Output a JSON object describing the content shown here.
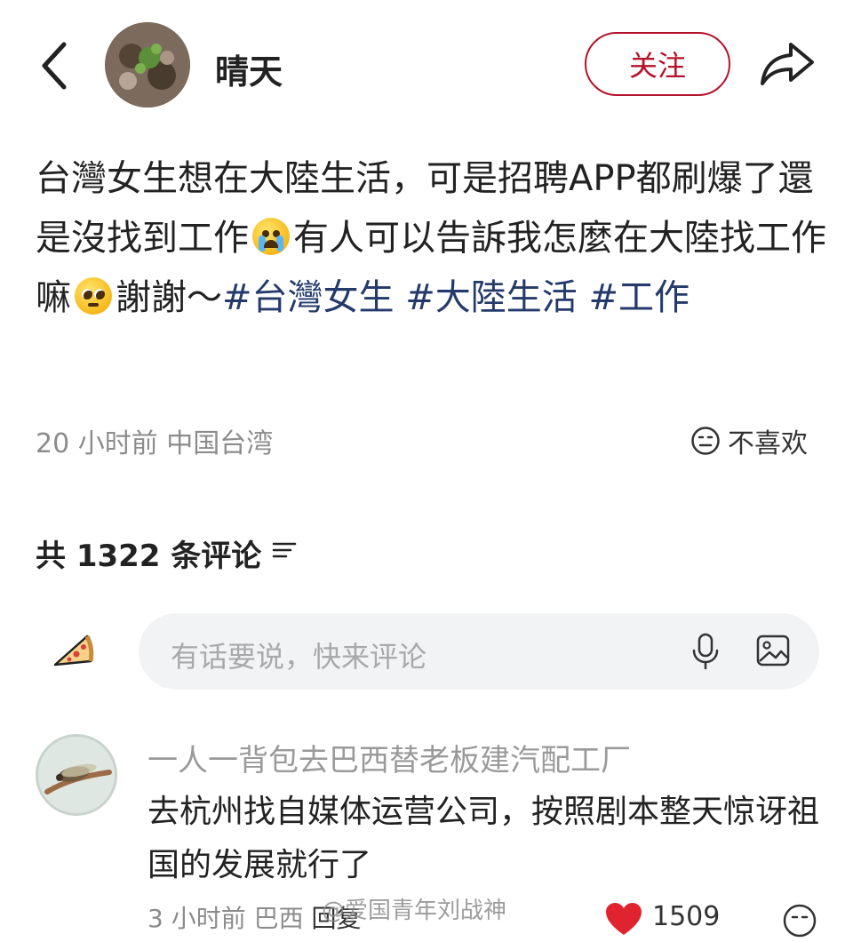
{
  "header": {
    "username": "晴天",
    "follow_label": "关注"
  },
  "post": {
    "text_1": "台灣女生想在大陸生活，可是招聘APP都刷爆了還是沒找到工作",
    "text_2": "有人可以告訴我怎麼在大陸找工作嘛",
    "text_3": "謝謝～",
    "hashtags": [
      "#台灣女生",
      "#大陸生活",
      "#工作"
    ],
    "emojis": [
      "loudly-crying-face",
      "pleading-face"
    ],
    "time": "20 小时前",
    "location": "中国台湾",
    "dislike_label": "不喜欢"
  },
  "comments_section": {
    "count_label": "共 1322 条评论"
  },
  "comment_input": {
    "placeholder": "有话要说，快来评论"
  },
  "comments": [
    {
      "author": "一人一背包去巴西替老板建汽配工厂",
      "text": "去杭州找自媒体运营公司，按照剧本整天惊讶祖国的发展就行了",
      "time": "3 小时前",
      "location": "巴西",
      "reply_label": "回复",
      "likes": "1509"
    }
  ],
  "watermark": "@爱国青年刘战神",
  "colors": {
    "accent_red": "#b3132a",
    "hashtag_blue": "#233a6b",
    "meta_gray": "#8c8c8c",
    "input_bg": "#f2f3f5"
  }
}
